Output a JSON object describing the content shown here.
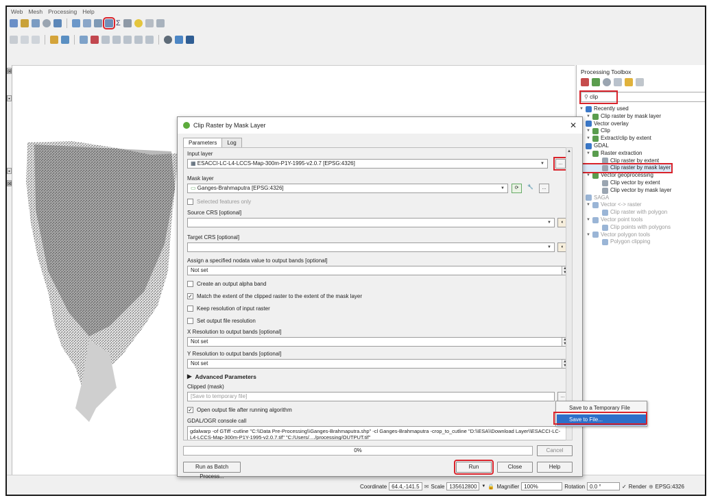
{
  "menubar": [
    "Web",
    "Mesh",
    "Processing",
    "Help"
  ],
  "toolbox": {
    "title": "Processing Toolbox",
    "search_value": "clip",
    "tree": [
      {
        "label": "Recently used",
        "level": 0,
        "grey": false
      },
      {
        "label": "Clip raster by mask layer",
        "level": 1,
        "grey": false
      },
      {
        "label": "Vector overlay",
        "level": 0,
        "grey": false
      },
      {
        "label": "Clip",
        "level": 1,
        "grey": false
      },
      {
        "label": "Extract/clip by extent",
        "level": 1,
        "grey": false
      },
      {
        "label": "GDAL",
        "level": 0,
        "grey": false
      },
      {
        "label": "Raster extraction",
        "level": 1,
        "grey": false
      },
      {
        "label": "Clip raster by extent",
        "level": 2,
        "grey": false
      },
      {
        "label": "Clip raster by mask layer",
        "level": 2,
        "grey": false,
        "highlighted": true
      },
      {
        "label": "Vector geoprocessing",
        "level": 1,
        "grey": false
      },
      {
        "label": "Clip vector by extent",
        "level": 2,
        "grey": false
      },
      {
        "label": "Clip vector by mask layer",
        "level": 2,
        "grey": false
      },
      {
        "label": "SAGA",
        "level": 0,
        "grey": true
      },
      {
        "label": "Vector <-> raster",
        "level": 1,
        "grey": true
      },
      {
        "label": "Clip raster with polygon",
        "level": 2,
        "grey": true
      },
      {
        "label": "Vector point tools",
        "level": 1,
        "grey": true
      },
      {
        "label": "Clip points with polygons",
        "level": 2,
        "grey": true
      },
      {
        "label": "Vector polygon tools",
        "level": 1,
        "grey": true
      },
      {
        "label": "Polygon clipping",
        "level": 2,
        "grey": true
      }
    ]
  },
  "dialog": {
    "title": "Clip Raster by Mask Layer",
    "tabs": [
      "Parameters",
      "Log"
    ],
    "input_layer_label": "Input layer",
    "input_layer_value": "ESACCI-LC-L4-LCCS-Map-300m-P1Y-1995-v2.0.7 [EPSG:4326]",
    "mask_layer_label": "Mask layer",
    "mask_layer_value": "Ganges-Brahmaputra [EPSG:4326]",
    "selected_only": "Selected features only",
    "source_crs_label": "Source CRS [optional]",
    "target_crs_label": "Target CRS [optional]",
    "nodata_label": "Assign a specified nodata value to output bands [optional]",
    "nodata_value": "Not set",
    "alpha_band": "Create an output alpha band",
    "match_extent": "Match the extent of the clipped raster to the extent of the mask layer",
    "keep_resolution": "Keep resolution of input raster",
    "set_resolution": "Set output file resolution",
    "xres_label": "X Resolution to output bands [optional]",
    "xres_value": "Not set",
    "yres_label": "Y Resolution to output bands [optional]",
    "yres_value": "Not set",
    "advanced": "Advanced Parameters",
    "clipped_label": "Clipped (mask)",
    "clipped_placeholder": "[Save to temporary file]",
    "open_output": "Open output file after running algorithm",
    "console_label": "GDAL/OGR console call",
    "console_value": "gdalwarp -of GTiff -cutline \"C:\\\\Data Pre-Processing\\\\Ganges-Brahmaputra.shp\" -cl Ganges-Brahmaputra -crop_to_cutline \"D:\\\\ESA\\\\Download Layer\\\\ESACCI-LC-L4-LCCS-Map-300m-P1Y-1995-v2.0.7.tif\" \"C:/Users/..../processing/OUTPUT.tif\"",
    "progress": "0%",
    "cancel": "Cancel",
    "batch": "Run as Batch Process...",
    "run": "Run",
    "close": "Close",
    "help": "Help",
    "browse": "..."
  },
  "save_menu": {
    "items": [
      "Save to a Temporary File",
      "Save to File..."
    ]
  },
  "statusbar": {
    "coordinate_label": "Coordinate",
    "coordinate_value": "64.4,-141.5",
    "scale_label": "Scale",
    "scale_value": "135612800",
    "magnifier_label": "Magnifier",
    "magnifier_value": "100%",
    "rotation_label": "Rotation",
    "rotation_value": "0.0 °",
    "render_label": "Render",
    "crs_value": "EPSG:4326"
  }
}
